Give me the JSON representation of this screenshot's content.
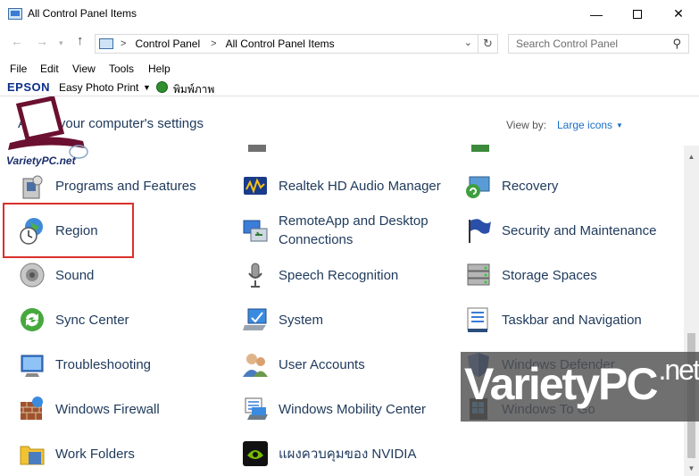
{
  "window": {
    "title": "All Control Panel Items",
    "minimize_glyph": "—",
    "close_glyph": "✕"
  },
  "nav": {
    "back_glyph": "←",
    "forward_glyph": "→",
    "recent_glyph": "▾",
    "up_glyph": "↑"
  },
  "address": {
    "crumbs": [
      "Control Panel",
      "All Control Panel Items"
    ],
    "separator": ">",
    "dropdown_glyph": "⌄",
    "refresh_glyph": "↻"
  },
  "search": {
    "placeholder": "Search Control Panel",
    "icon_glyph": "⚲"
  },
  "menu": [
    "File",
    "Edit",
    "View",
    "Tools",
    "Help"
  ],
  "epson": {
    "logo": "EPSON",
    "easy_photo_print": "Easy Photo Print",
    "dropdown_glyph": "▼",
    "print_label": "พิมพ์ภาพ"
  },
  "content": {
    "heading": "Adjust your computer's settings",
    "view_by_label": "View by:",
    "view_by_value": "Large icons",
    "view_by_glyph": "▼"
  },
  "items": [
    {
      "label": "Programs and Features",
      "icon": "programs-features-icon",
      "col": 0,
      "row": 0
    },
    {
      "label": "Realtek HD Audio Manager",
      "icon": "realtek-audio-icon",
      "col": 1,
      "row": 0
    },
    {
      "label": "Recovery",
      "icon": "recovery-icon",
      "col": 2,
      "row": 0
    },
    {
      "label": "Region",
      "icon": "region-icon",
      "col": 0,
      "row": 1
    },
    {
      "label": "RemoteApp and Desktop Connections",
      "icon": "remoteapp-icon",
      "col": 1,
      "row": 1
    },
    {
      "label": "Security and Maintenance",
      "icon": "security-flag-icon",
      "col": 2,
      "row": 1
    },
    {
      "label": "Sound",
      "icon": "speaker-icon",
      "col": 0,
      "row": 2
    },
    {
      "label": "Speech Recognition",
      "icon": "microphone-icon",
      "col": 1,
      "row": 2
    },
    {
      "label": "Storage Spaces",
      "icon": "storage-spaces-icon",
      "col": 2,
      "row": 2
    },
    {
      "label": "Sync Center",
      "icon": "sync-icon",
      "col": 0,
      "row": 3
    },
    {
      "label": "System",
      "icon": "system-icon",
      "col": 1,
      "row": 3
    },
    {
      "label": "Taskbar and Navigation",
      "icon": "taskbar-icon",
      "col": 2,
      "row": 3
    },
    {
      "label": "Troubleshooting",
      "icon": "troubleshooting-icon",
      "col": 0,
      "row": 4
    },
    {
      "label": "User Accounts",
      "icon": "user-accounts-icon",
      "col": 1,
      "row": 4
    },
    {
      "label": "Windows Defender",
      "icon": "defender-shield-icon",
      "col": 2,
      "row": 4
    },
    {
      "label": "Windows Firewall",
      "icon": "firewall-icon",
      "col": 0,
      "row": 5
    },
    {
      "label": "Windows Mobility Center",
      "icon": "mobility-center-icon",
      "col": 1,
      "row": 5
    },
    {
      "label": "Windows To Go",
      "icon": "windows-to-go-icon",
      "col": 2,
      "row": 5
    },
    {
      "label": "Work Folders",
      "icon": "work-folders-icon",
      "col": 0,
      "row": 6
    },
    {
      "label": "แผงควบคุมของ NVIDIA",
      "icon": "nvidia-icon",
      "col": 1,
      "row": 6
    }
  ],
  "watermark": {
    "variety": "Variety",
    "pc": "PC",
    "net": ".net"
  },
  "logo": {
    "text": "VarietyPC.net"
  }
}
